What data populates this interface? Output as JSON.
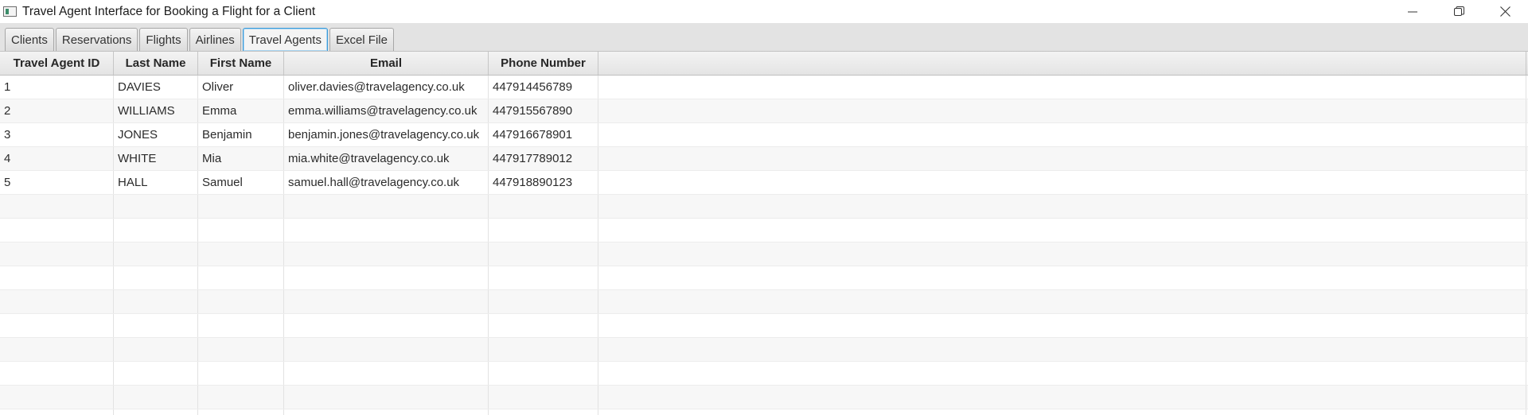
{
  "window": {
    "title": "Travel Agent Interface for Booking a Flight for a Client",
    "app_icon": "java-app-icon",
    "controls": [
      "minimize-icon",
      "restore-icon",
      "close-icon"
    ]
  },
  "tabs": [
    {
      "label": "Clients",
      "selected": false
    },
    {
      "label": "Reservations",
      "selected": false
    },
    {
      "label": "Flights",
      "selected": false
    },
    {
      "label": "Airlines",
      "selected": false
    },
    {
      "label": "Travel Agents",
      "selected": true
    },
    {
      "label": "Excel File",
      "selected": false
    }
  ],
  "table": {
    "columns": [
      "Travel Agent ID",
      "Last Name",
      "First Name",
      "Email",
      "Phone Number"
    ],
    "rows": [
      [
        "1",
        "DAVIES",
        "Oliver",
        "oliver.davies@travelagency.co.uk",
        "447914456789"
      ],
      [
        "2",
        "WILLIAMS",
        "Emma",
        "emma.williams@travelagency.co.uk",
        "447915567890"
      ],
      [
        "3",
        "JONES",
        "Benjamin",
        "benjamin.jones@travelagency.co.uk",
        "447916678901"
      ],
      [
        "4",
        "WHITE",
        "Mia",
        "mia.white@travelagency.co.uk",
        "447917789012"
      ],
      [
        "5",
        "HALL",
        "Samuel",
        "samuel.hall@travelagency.co.uk",
        "447918890123"
      ]
    ],
    "empty_rows": 10
  },
  "colors": {
    "selected_tab_border": "#3a9ad9",
    "tab_header_bg": "#e3e3e3",
    "row_alt_bg": "#f7f7f7"
  }
}
